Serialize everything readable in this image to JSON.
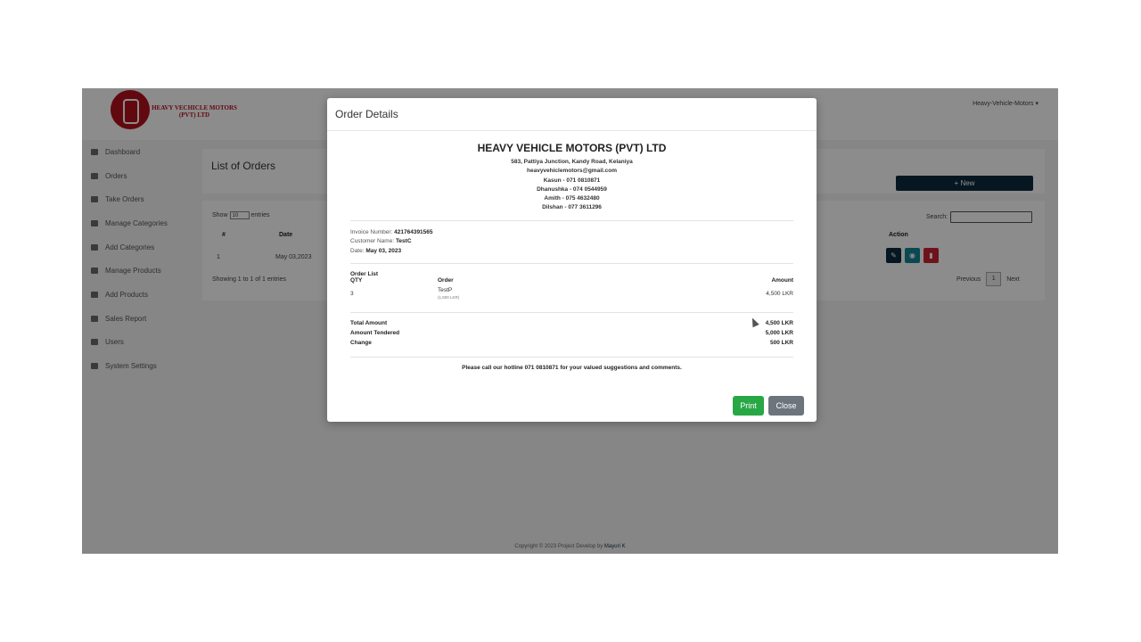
{
  "app": {
    "logo_text": "HEAVY VECHICLE MOTORS (PVT) LTD",
    "user_menu": "Heavy-Vehicle-Motors ▾",
    "sidebar": [
      {
        "label": "Dashboard",
        "icon": "dashboard-icon"
      },
      {
        "label": "Orders",
        "icon": "orders-icon"
      },
      {
        "label": "Take Orders",
        "icon": "list-icon"
      },
      {
        "label": "Manage Categories",
        "icon": "folder-icon"
      },
      {
        "label": "Add Categories",
        "icon": "folder-plus-icon"
      },
      {
        "label": "Manage Products",
        "icon": "list-icon"
      },
      {
        "label": "Add Products",
        "icon": "list-icon"
      },
      {
        "label": "Sales Report",
        "icon": "report-icon"
      },
      {
        "label": "Users",
        "icon": "users-icon"
      },
      {
        "label": "System Settings",
        "icon": "gears-icon"
      }
    ],
    "page_title": "List of Orders",
    "new_button": "+ New",
    "show_label": "Show",
    "entries_value": "10",
    "entries_label": "entries",
    "search_label": "Search:",
    "columns": {
      "num": "#",
      "date": "Date",
      "action": "Action"
    },
    "row": {
      "num": "1",
      "date": "May 03,2023"
    },
    "info": "Showing 1 to 1 of 1 entries",
    "pager": {
      "prev": "Previous",
      "page": "1",
      "next": "Next"
    },
    "footer_text": "Copyright © 2023 Project Develop by",
    "footer_author": "Mayuri K"
  },
  "modal": {
    "title": "Order Details",
    "company": "HEAVY VEHICLE MOTORS (PVT) LTD",
    "address_lines": [
      "583, Pattiya Junction, Kandy Road, Kelaniya",
      "heavyvehiclemotors@gmail.com",
      "Kasun - 071 0810871",
      "Dhanushka - 074 0544959",
      "Amith - 075 4632480",
      "Dilshan - 077 3611296"
    ],
    "invoice_label": "Invoice Number:",
    "invoice_number": "421764391565",
    "customer_label": "Customer Name:",
    "customer_name": "TestC",
    "date_label": "Date:",
    "date_value": "May 03, 2023",
    "order_list_title": "Order List",
    "col_qty": "QTY",
    "col_order": "Order",
    "col_amount": "Amount",
    "item": {
      "qty": "3",
      "name": "TestP",
      "unit": "(1,500 LKR)",
      "amount": "4,500 LKR"
    },
    "totals": {
      "total_label": "Total Amount",
      "total_value": "4,500 LKR",
      "tendered_label": "Amount Tendered",
      "tendered_value": "5,000 LKR",
      "change_label": "Change",
      "change_value": "500 LKR"
    },
    "thank_you": "Please call our hotline 071 0810871 for your valued suggestions and comments.",
    "print_button": "Print",
    "close_button": "Close"
  }
}
